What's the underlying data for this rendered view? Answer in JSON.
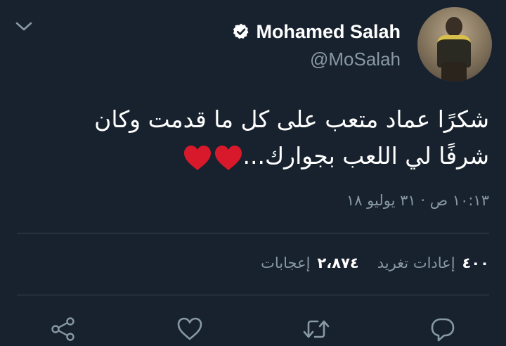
{
  "tweet": {
    "display_name": "Mohamed Salah",
    "handle": "@MoSalah",
    "verified": true,
    "text_line1": "شكرًا عماد متعب على كل ما قدمت وكان",
    "text_line2": "شرفًا لي اللعب بجوارك...",
    "emoji": [
      "red-heart",
      "red-heart"
    ],
    "timestamp": "١٠:١٣ ص · ٣١ يوليو ١٨"
  },
  "stats": {
    "retweets_count": "٤٠٠",
    "retweets_label": "إعادات تغريد",
    "likes_count": "٢،٨٧٤",
    "likes_label": "إعجابات"
  },
  "colors": {
    "background": "#18222e",
    "text": "#ffffff",
    "secondary": "#8899a6",
    "divider": "#38444d",
    "heart": "#e0245e",
    "emoji_heart": "#d8192b"
  },
  "icons": {
    "menu": "chevron-down-icon",
    "verified": "verified-badge-icon",
    "actions": [
      "share-icon",
      "like-icon",
      "retweet-icon",
      "reply-icon"
    ]
  }
}
